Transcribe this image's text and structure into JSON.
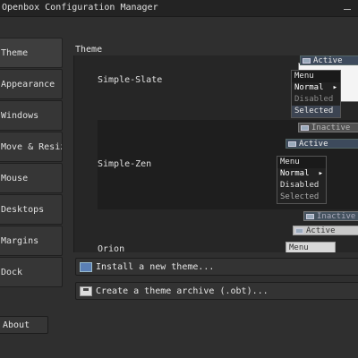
{
  "window": {
    "title": "Openbox Configuration Manager"
  },
  "sidebar": {
    "items": [
      {
        "label": "Theme"
      },
      {
        "label": "Appearance"
      },
      {
        "label": "Windows"
      },
      {
        "label": "Move & Resize"
      },
      {
        "label": "Mouse"
      },
      {
        "label": "Desktops"
      },
      {
        "label": "Margins"
      },
      {
        "label": "Dock"
      }
    ],
    "selected_index": 0,
    "about_label": "About"
  },
  "main": {
    "section_label": "Theme",
    "themes": [
      {
        "name": "Simple-Slate"
      },
      {
        "name": "Simple-Zen"
      },
      {
        "name": "Orion"
      }
    ],
    "preview_labels": {
      "active": "Active",
      "inactive": "Inactive",
      "menu": "Menu",
      "normal": "Normal",
      "disabled": "Disabled",
      "selected": "Selected"
    },
    "install_button": "Install a new theme...",
    "archive_button": "Create a theme archive (.obt)..."
  },
  "colors": {
    "background": "#2f2f2f",
    "titlebar": "#232323",
    "list_background": "#262626",
    "active_bar": "#3d4a5c",
    "selected_menu_item": "#3c4452"
  }
}
